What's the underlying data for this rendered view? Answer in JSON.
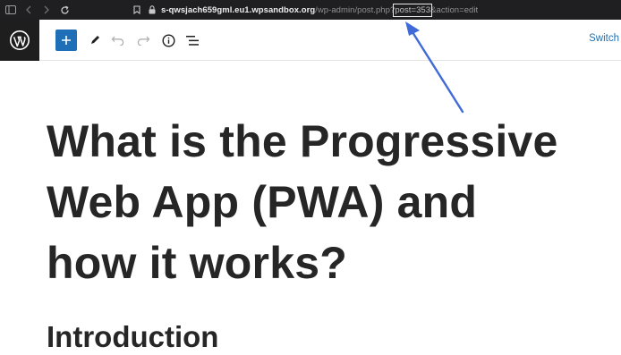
{
  "browser": {
    "url_host": "s-qwsjach659gml.eu1.wpsandbox.org",
    "url_path_prefix": "/wp-admin/post.php",
    "url_separator": "?",
    "url_highlight": "post=353",
    "url_suffix": "&action=edit",
    "icons": [
      "sidebar-icon",
      "back-icon",
      "forward-icon",
      "reload-icon",
      "bookmark-icon",
      "lock-icon"
    ]
  },
  "toolbar": {
    "logo_icon": "wordpress-logo-icon",
    "add_icon": "plus-icon",
    "tools_icon": "pencil-icon",
    "undo_icon": "undo-icon",
    "redo_icon": "redo-icon",
    "details_icon": "info-icon",
    "list_view_icon": "list-view-icon",
    "switch_label": "Switch"
  },
  "post": {
    "title_line1": "What is the Progressive",
    "title_line2": "Web App (PWA) and",
    "title_line3": "how it works?",
    "heading": "Introduction"
  },
  "colors": {
    "browser_bar": "#1f1f22",
    "accent": "#1e6fb8",
    "annotation_arrow": "#3f6ad8",
    "link": "#2271b1"
  }
}
